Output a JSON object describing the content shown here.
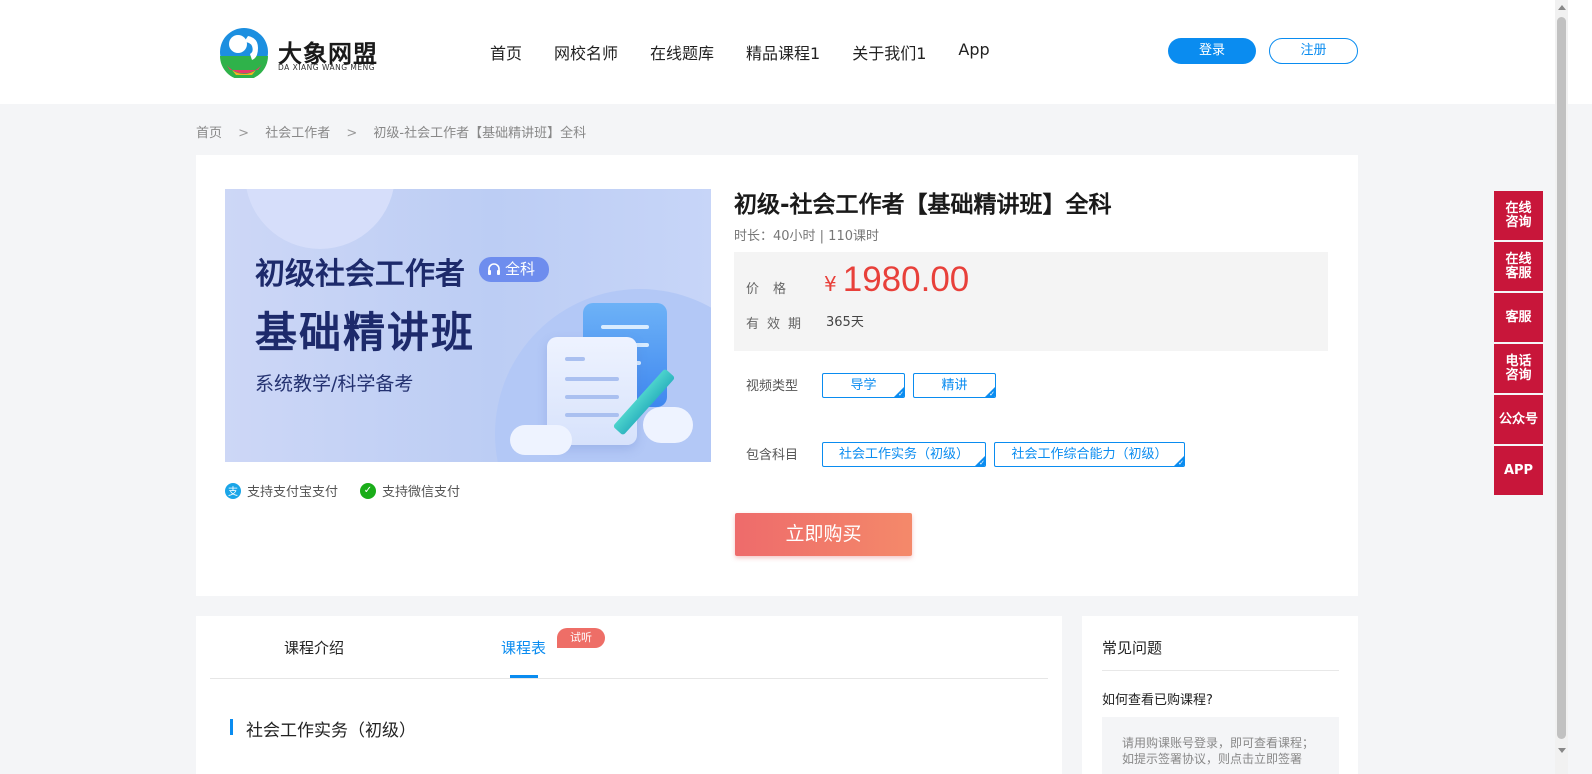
{
  "header": {
    "logo_text": "大象网盟",
    "logo_sub": "DA XIANG WANG MENG",
    "nav": [
      "首页",
      "网校名师",
      "在线题库",
      "精品课程1",
      "关于我们1",
      "App"
    ],
    "login_label": "登录",
    "register_label": "注册"
  },
  "breadcrumb": [
    "首页",
    ">",
    "社会工作者",
    ">",
    "初级-社会工作者【基础精讲班】全科"
  ],
  "product": {
    "cover": {
      "title": "初级社会工作者",
      "tag": "全科",
      "subtitle": "基础精讲班",
      "desc": "系统教学/科学备考"
    },
    "pay_alipay": "支持支付宝支付",
    "pay_wechat": "支持微信支付",
    "title": "初级-社会工作者【基础精讲班】全科",
    "meta": "时长：40小时 | 110课时",
    "price_label": "价格",
    "currency": "¥",
    "price": "1980.00",
    "valid_label": "有效期",
    "valid_value": "365天",
    "video_type_label": "视频类型",
    "video_types": [
      "导学",
      "精讲"
    ],
    "subjects_label": "包含科目",
    "subjects": [
      "社会工作实务（初级）",
      "社会工作综合能力（初级）"
    ],
    "buy_label": "立即购买"
  },
  "tabs": {
    "intro": "课程介绍",
    "schedule": "课程表",
    "badge": "试听",
    "section_title": "社会工作实务（初级）"
  },
  "faq": {
    "title": "常见问题",
    "question": "如何查看已购课程?",
    "answer": "请用购课账号登录，即可查看课程；如提示签署协议，则点击立即签署"
  },
  "float": [
    "在线\n咨询",
    "在线\n客服",
    "客服",
    "电话\n咨询",
    "公众号",
    "APP"
  ],
  "colors": {
    "accent": "#0a8cf0",
    "price": "#e8403a",
    "float_bg": "#c8163a"
  }
}
